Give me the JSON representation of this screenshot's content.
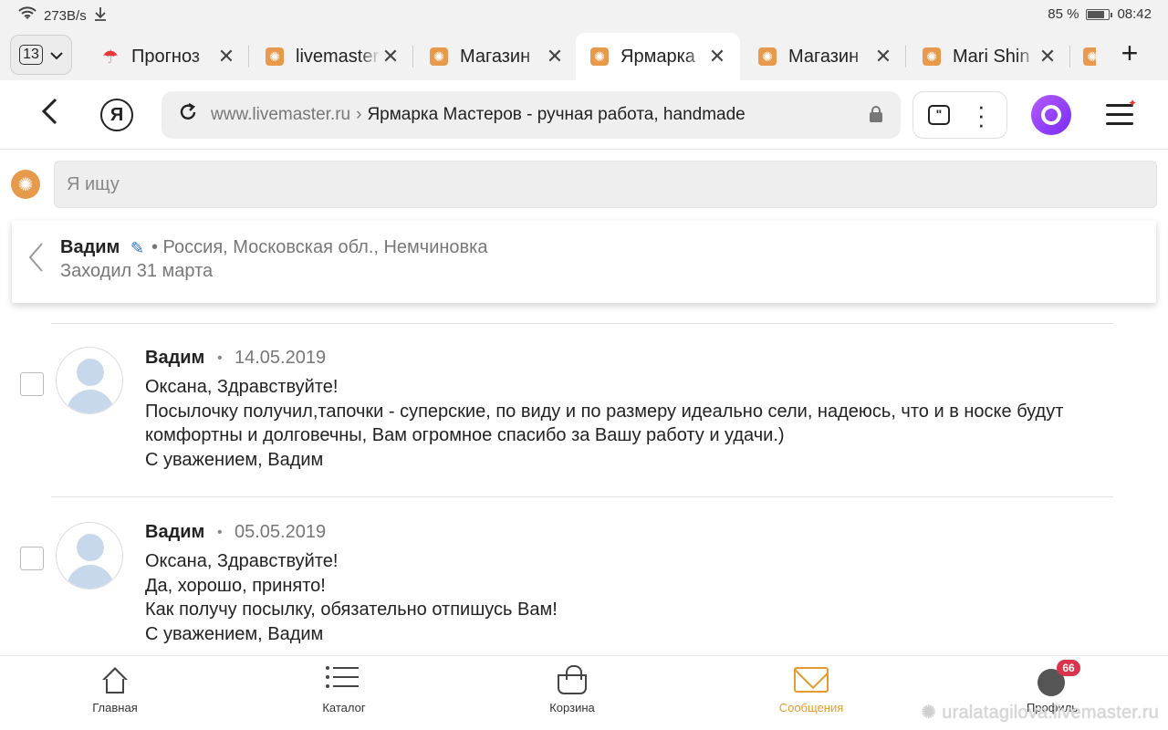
{
  "status": {
    "speed": "273B/s",
    "battery": "85 %",
    "battery_level": 0.85,
    "time": "08:42"
  },
  "tabs": {
    "count": "13",
    "items": [
      {
        "title": "Прогноз",
        "favicon": "umbrella-icon",
        "active": false
      },
      {
        "title": "livemaster",
        "favicon": "livemaster-icon",
        "active": false
      },
      {
        "title": "Магазин",
        "favicon": "livemaster-icon",
        "active": false
      },
      {
        "title": "Ярмарка",
        "favicon": "livemaster-icon",
        "active": true
      },
      {
        "title": "Магазин",
        "favicon": "livemaster-icon",
        "active": false
      },
      {
        "title": "Mari Shin",
        "favicon": "livemaster-icon",
        "active": false
      }
    ]
  },
  "address": {
    "host": "www.livemaster.ru",
    "separator": "›",
    "page_title": "Ярмарка Мастеров - ручная работа, handmade"
  },
  "search": {
    "placeholder": "Я ищу"
  },
  "dialog": {
    "name": "Вадим",
    "location": "• Россия, Московская обл., Немчиновка",
    "last_seen": "Заходил 31 марта"
  },
  "messages": [
    {
      "author": "Вадим",
      "dot": "•",
      "date": "14.05.2019",
      "lines": [
        "Оксана, Здравствуйте!",
        "Посылочку получил,тапочки - суперские, по виду и по размеру идеально сели, надеюсь, что и в носке будут комфортны и долговечны, Вам огромное спасибо за Вашу работу и удачи.)",
        "С уважением, Вадим"
      ]
    },
    {
      "author": "Вадим",
      "dot": "•",
      "date": "05.05.2019",
      "lines": [
        "Оксана, Здравствуйте!",
        "Да, хорошо, принято!",
        "Как получу посылку, обязательно отпишусь Вам!",
        "С уважением, Вадим"
      ]
    }
  ],
  "bottom_nav": {
    "home": "Главная",
    "catalog": "Каталог",
    "cart": "Корзина",
    "messages": "Сообщения",
    "profile": "Профиль",
    "profile_badge": "66",
    "active": "messages",
    "active_color": "#e59b2f"
  },
  "watermark": "uralatagilova.livemaster.ru"
}
